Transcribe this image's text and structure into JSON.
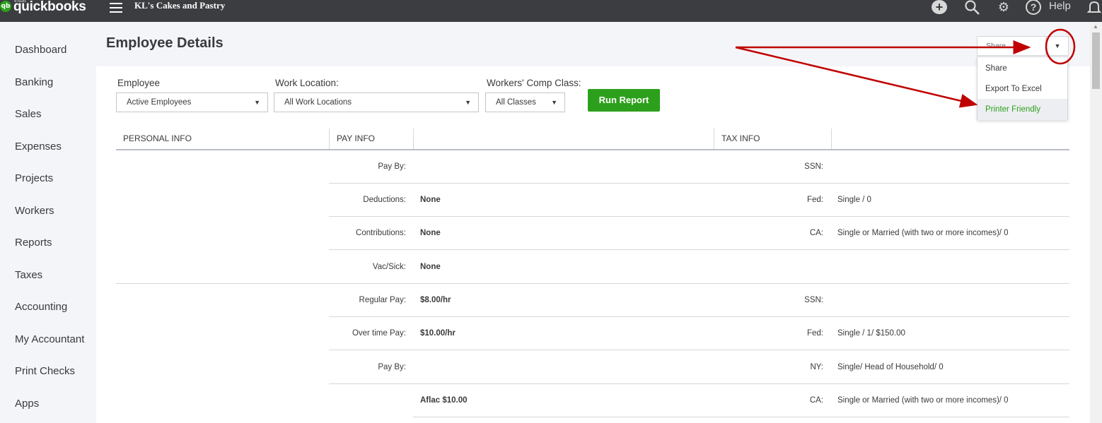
{
  "topbar": {
    "intuit": "intuit",
    "brand": "quickbooks",
    "logo_glyph": "qb",
    "company": "KL's Cakes and Pastry",
    "help_label": "Help",
    "plus_glyph": "+",
    "search_glyph": "⚲",
    "gear_glyph": "⚙",
    "help_glyph": "?",
    "bell_glyph": "🔔"
  },
  "sidebar": {
    "items": [
      "Dashboard",
      "Banking",
      "Sales",
      "Expenses",
      "Projects",
      "Workers",
      "Reports",
      "Taxes",
      "Accounting",
      "My Accountant",
      "Print Checks",
      "Apps"
    ]
  },
  "page": {
    "title": "Employee Details"
  },
  "filters": {
    "employee_label": "Employee",
    "employee_value": "Active Employees",
    "location_label": "Work Location:",
    "location_value": "All Work Locations",
    "comp_label": "Workers' Comp Class:",
    "comp_value": "All Classes",
    "caret": "▼",
    "run_report": "Run Report"
  },
  "share": {
    "button_label": "Share",
    "toggle_glyph": "▼",
    "menu": [
      "Share",
      "Export To Excel",
      "Printer Friendly"
    ]
  },
  "scroll": {
    "up_glyph": "▲"
  },
  "table": {
    "headers": {
      "personal": "PERSONAL INFO",
      "pay": "PAY INFO",
      "tax": "TAX INFO"
    },
    "rows": [
      {
        "pay_label": "Pay By:",
        "pay_value": "",
        "tax_label": "SSN:",
        "tax_value": ""
      },
      {
        "pay_label": "Deductions:",
        "pay_value": "None",
        "tax_label": "Fed:",
        "tax_value": "Single / 0"
      },
      {
        "pay_label": "Contributions:",
        "pay_value": "None",
        "tax_label": "CA:",
        "tax_value": "Single or Married (with two or more incomes)/ 0"
      },
      {
        "pay_label": "Vac/Sick:",
        "pay_value": "None",
        "tax_label": "",
        "tax_value": ""
      },
      {
        "pay_label": "Regular Pay:",
        "pay_value": "$8.00/hr",
        "tax_label": "SSN:",
        "tax_value": ""
      },
      {
        "pay_label": "Over time Pay:",
        "pay_value": "$10.00/hr",
        "tax_label": "Fed:",
        "tax_value": "Single / 1/ $150.00"
      },
      {
        "pay_label": "Pay By:",
        "pay_value": "",
        "tax_label": "NY:",
        "tax_value": "Single/ Head of Household/ 0"
      },
      {
        "pay_label": "",
        "pay_value": "Aflac $10.00",
        "tax_label": "CA:",
        "tax_value": "Single or Married (with two or more incomes)/ 0"
      }
    ]
  },
  "colors": {
    "brand_green": "#2ca01c",
    "topbar": "#3b3d40",
    "annotation_red": "#c00000"
  }
}
